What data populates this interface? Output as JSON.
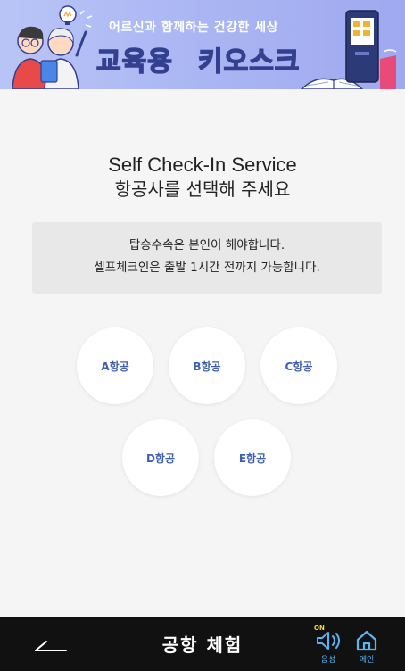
{
  "banner": {
    "subtitle": "어르신과 함께하는 건강한 세상",
    "title_edu": "교육용",
    "title_kiosk": "키오스크"
  },
  "heading": {
    "line1": "Self Check-In Service",
    "line2": "항공사를 선택해 주세요"
  },
  "notice": {
    "line1": "탑승수속은 본인이 해야합니다.",
    "line2": "셀프체크인은 출발 1시간 전까지 가능합니다."
  },
  "airlines": [
    "A항공",
    "B항공",
    "C항공",
    "D항공",
    "E항공"
  ],
  "bottom_bar": {
    "title": "공항 체험",
    "voice_on": "ON",
    "voice_label": "음성",
    "main_label": "메인"
  },
  "colors": {
    "accent": "#3f5fb2",
    "bottom_bar_bg": "#111111",
    "icon_blue": "#58b4f4",
    "on_yellow": "#ffd23a",
    "banner_bg": "#aab6f3"
  },
  "icons": {
    "back": "back-arrow-icon",
    "voice": "speaker-icon",
    "main": "home-icon"
  }
}
